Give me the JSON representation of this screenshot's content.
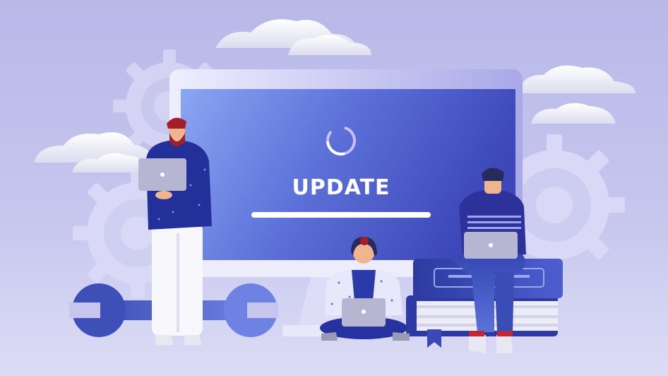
{
  "screen": {
    "title": "UPDATE",
    "progress": 1.0
  },
  "colors": {
    "background": "#bcbcea",
    "monitor_screen": "#5b6fd6",
    "monitor_bezel": "#ece9ff",
    "accent": "#5562d9",
    "gear": "#d7d6f5",
    "cloud": "#f4f4fb"
  },
  "icons": [
    "loading-spinner-icon",
    "gear-icon",
    "wrench-icon",
    "cloud-icon",
    "laptop-icon",
    "book-icon",
    "bookmark-icon"
  ]
}
